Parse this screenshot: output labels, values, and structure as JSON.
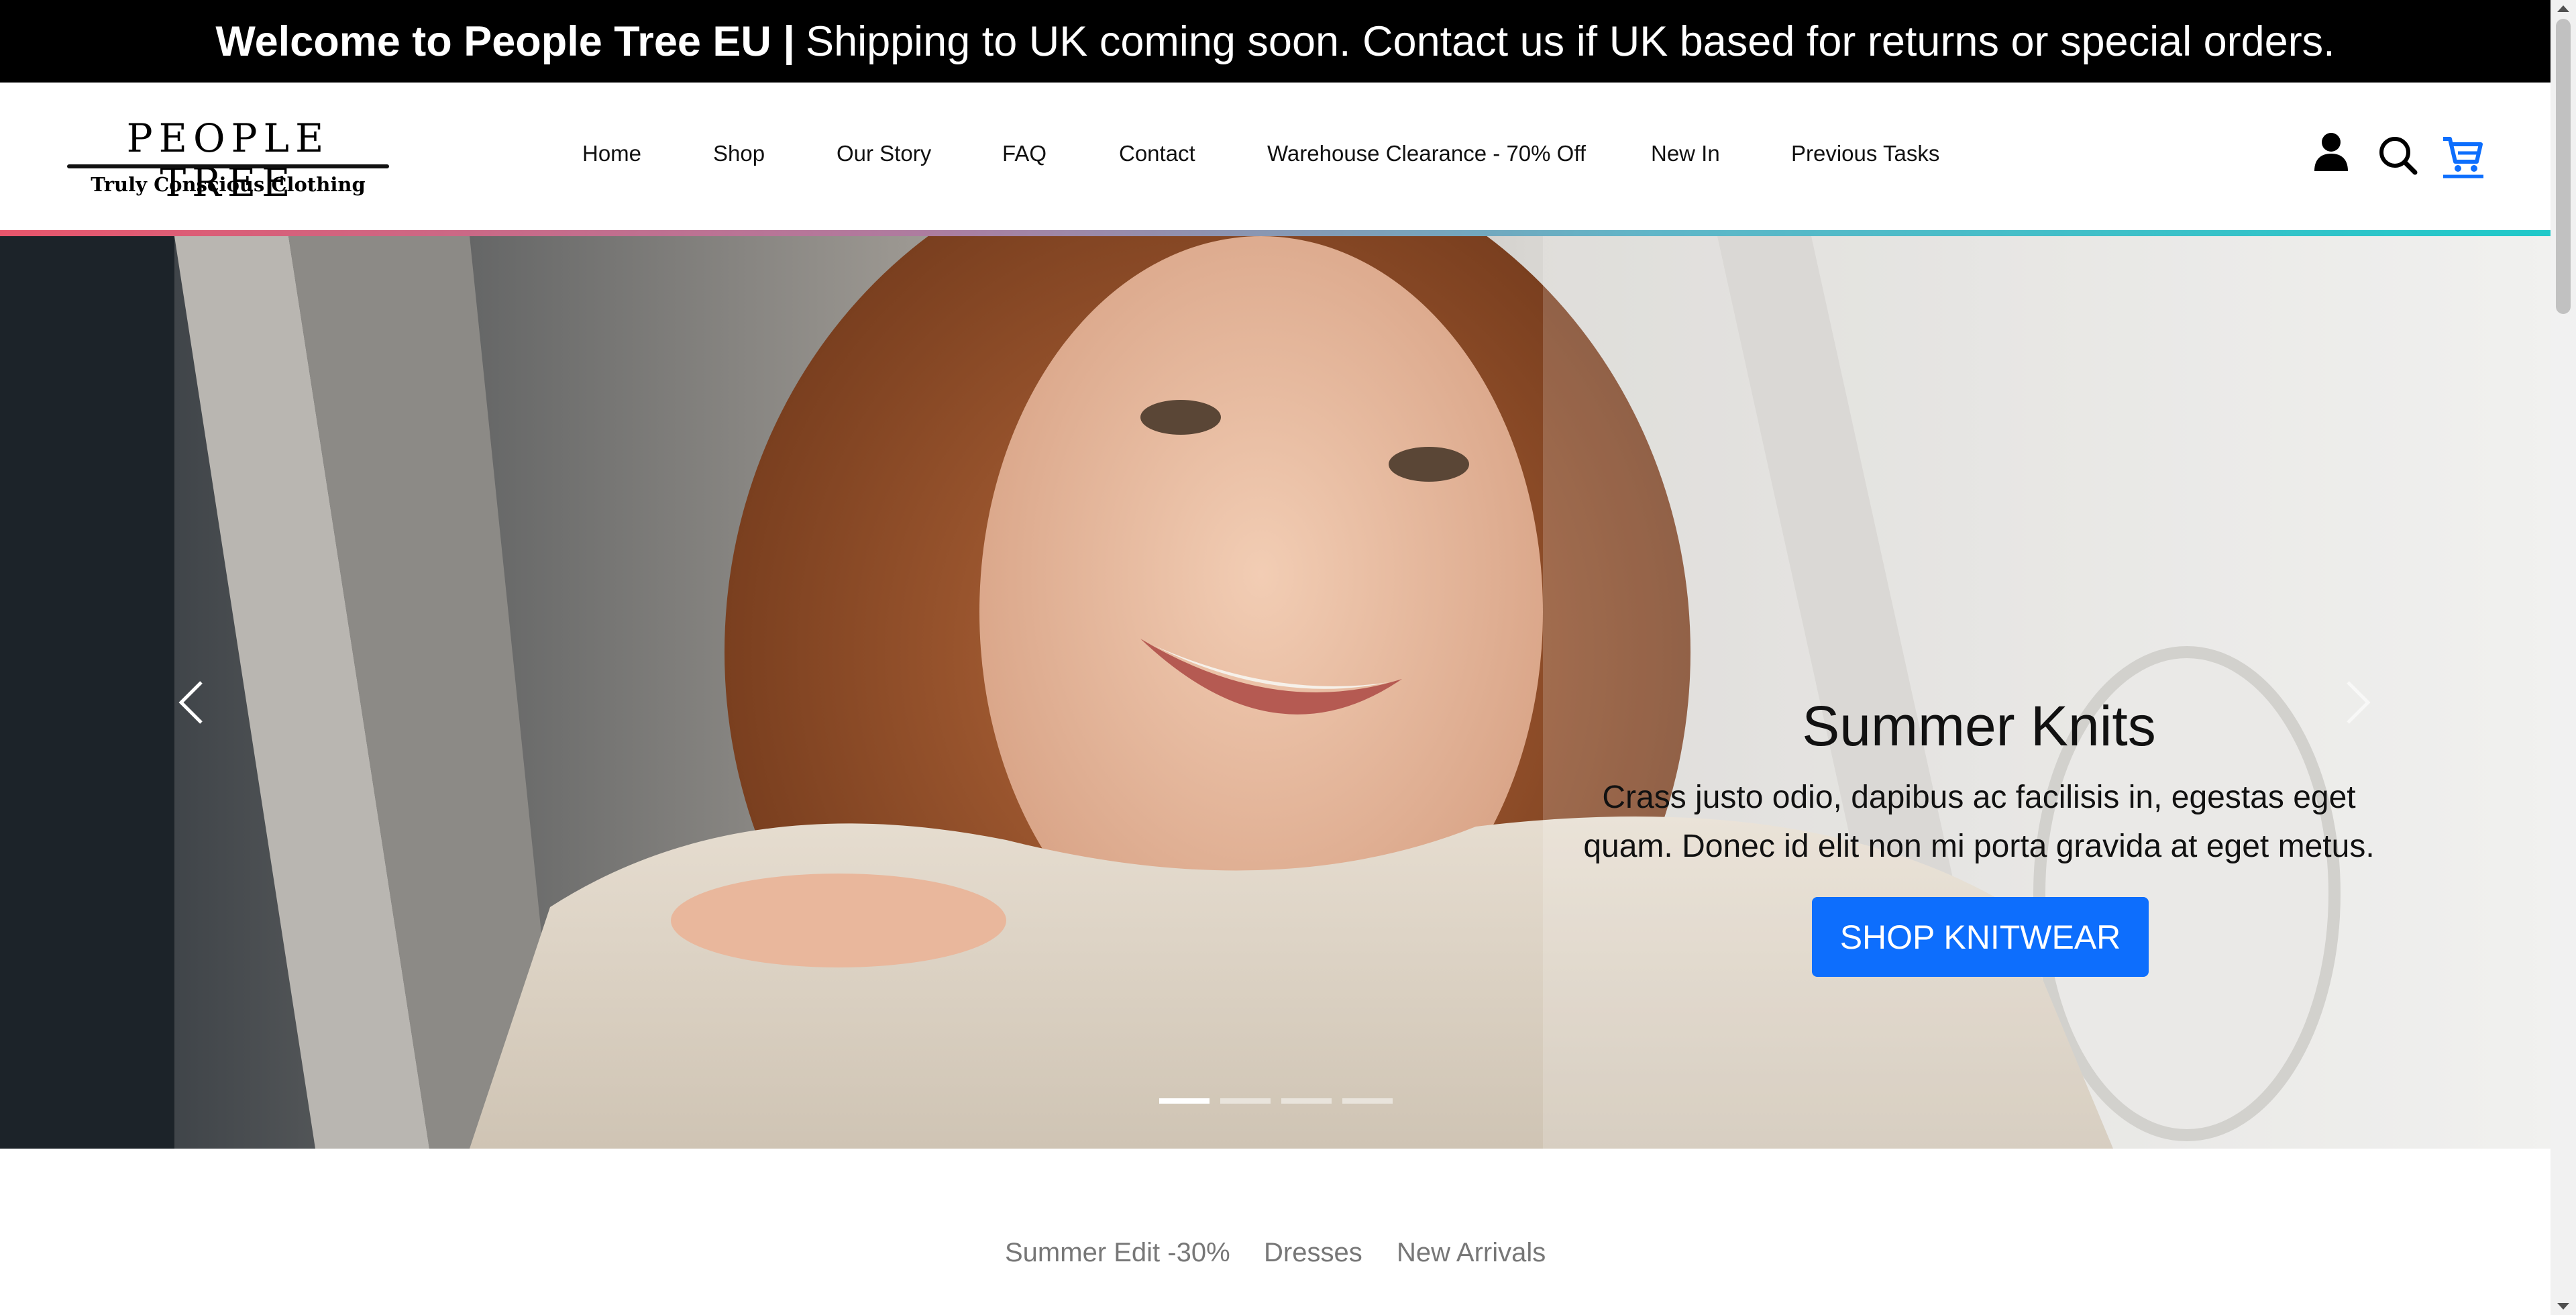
{
  "announcement": {
    "bold": "Welcome to People Tree EU |",
    "text": "Shipping to UK coming soon. Contact us if UK based for returns or special orders."
  },
  "logo": {
    "title": "PEOPLE TREE",
    "subtitle": "Truly Conscious Clothing"
  },
  "nav": {
    "items": [
      {
        "label": "Home"
      },
      {
        "label": "Shop"
      },
      {
        "label": "Our Story"
      },
      {
        "label": "FAQ"
      },
      {
        "label": "Contact"
      },
      {
        "label": "Warehouse Clearance - 70% Off"
      },
      {
        "label": "New In"
      },
      {
        "label": "Previous Tasks"
      }
    ]
  },
  "header_icons": {
    "account": "user-icon",
    "search": "search-icon",
    "cart": "cart-icon",
    "cart_color": "#0d6efd"
  },
  "hero": {
    "title": "Summer Knits",
    "text": "Crass justo odio, dapibus ac facilisis in, egestas eget quam. Donec id elit non mi porta gravida at eget metus.",
    "button": "SHOP KNITWEAR",
    "button_color": "#0d6efd",
    "slides_total": 4,
    "active_slide": 1
  },
  "categories": {
    "items": [
      {
        "label": "Summer Edit -30%"
      },
      {
        "label": "Dresses"
      },
      {
        "label": "New Arrivals"
      }
    ]
  },
  "colors": {
    "gradient_start": "#e8556b",
    "gradient_end": "#1fc9c9"
  }
}
